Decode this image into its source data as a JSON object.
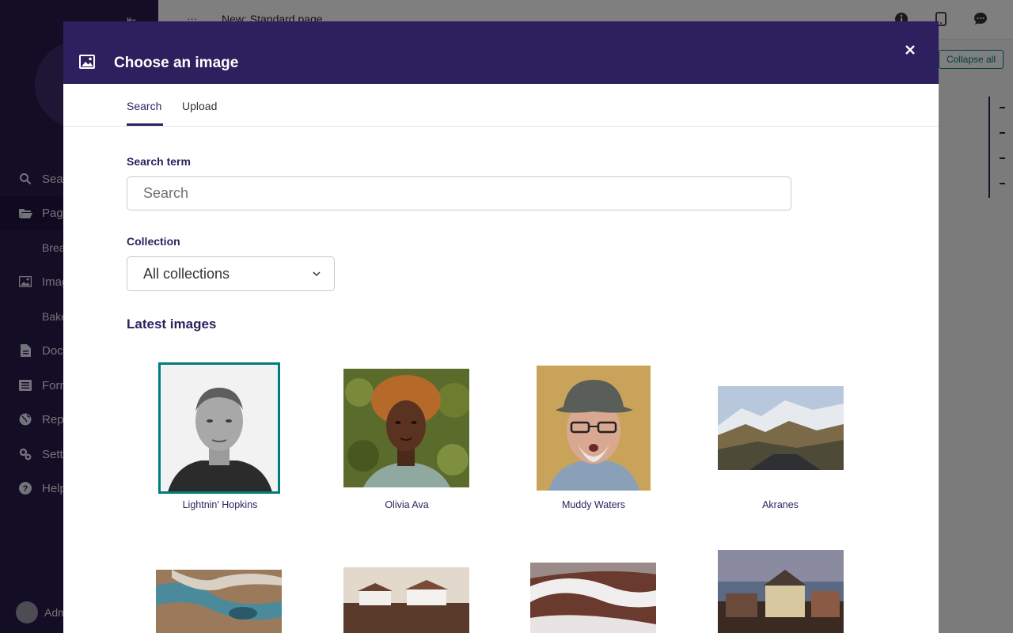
{
  "background": {
    "sidebar": {
      "items": [
        {
          "label": "Search",
          "icon": "search-icon",
          "sub": false
        },
        {
          "label": "Pages",
          "icon": "folder-open-icon",
          "sub": false,
          "active": true
        },
        {
          "label": "Breads",
          "icon": "",
          "sub": true
        },
        {
          "label": "Images",
          "icon": "image-icon",
          "sub": false
        },
        {
          "label": "Bakeries",
          "icon": "",
          "sub": true
        },
        {
          "label": "Documents",
          "icon": "document-icon",
          "sub": false
        },
        {
          "label": "Forms",
          "icon": "form-icon",
          "sub": false
        },
        {
          "label": "Reports",
          "icon": "globe-icon",
          "sub": false
        },
        {
          "label": "Settings",
          "icon": "cogs-icon",
          "sub": false
        },
        {
          "label": "Help",
          "icon": "help-icon",
          "sub": false
        }
      ],
      "user": "Admin"
    },
    "topbar": {
      "breadcrumb_dots": "···",
      "title": "New: Standard page"
    },
    "collapse_all_label": "Collapse all"
  },
  "modal": {
    "title": "Choose an image",
    "close_label": "×",
    "tabs": [
      {
        "label": "Search",
        "active": true
      },
      {
        "label": "Upload",
        "active": false
      }
    ],
    "search": {
      "label": "Search term",
      "placeholder": "Search"
    },
    "collection": {
      "label": "Collection",
      "selected": "All collections"
    },
    "latest_title": "Latest images",
    "images": [
      {
        "title": "Lightnin' Hopkins",
        "selected": true
      },
      {
        "title": "Olivia Ava",
        "selected": false
      },
      {
        "title": "Muddy Waters",
        "selected": false
      },
      {
        "title": "Akranes",
        "selected": false
      },
      {
        "title": "",
        "selected": false
      },
      {
        "title": "",
        "selected": false
      },
      {
        "title": "",
        "selected": false
      },
      {
        "title": "",
        "selected": false
      }
    ]
  },
  "colors": {
    "brand": "#2e1f5e",
    "accent": "#007d7e",
    "sidebar": "#261a4d"
  }
}
